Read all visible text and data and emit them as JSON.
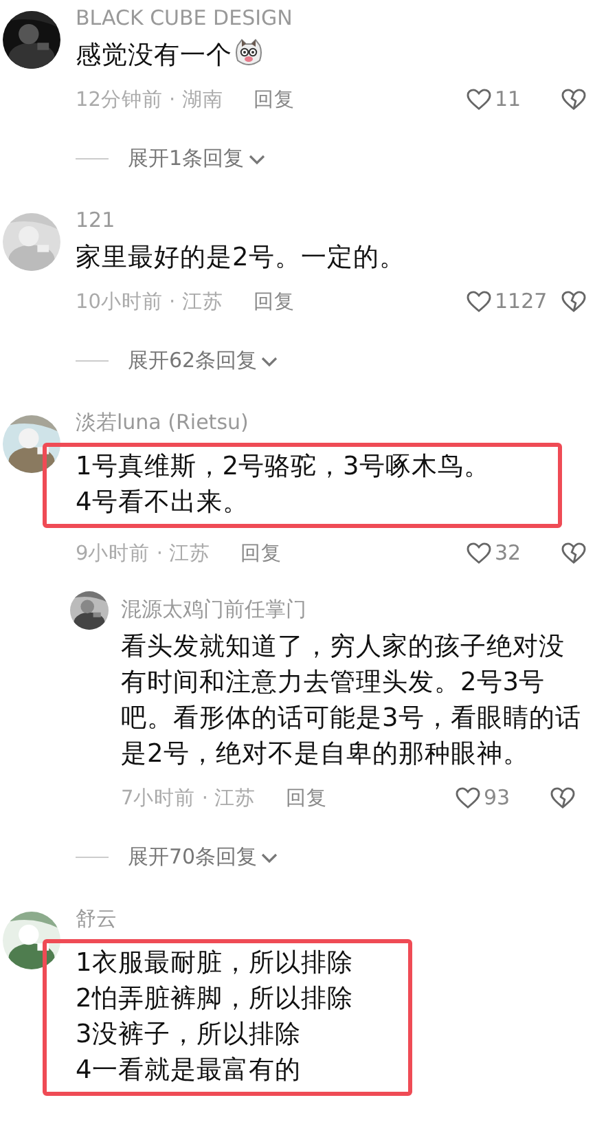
{
  "comments": [
    {
      "name": "BLACK CUBE DESIGN",
      "text": "感觉没有一个",
      "sticker": true,
      "time": "12分钟前 · 湖南",
      "reply": "回复",
      "likes": "11",
      "highlighted": false,
      "expand": "展开1条回复"
    },
    {
      "name": "121",
      "text": "家里最好的是2号。一定的。",
      "time": "10小时前 · 江苏",
      "reply": "回复",
      "likes": "1127",
      "highlighted": false,
      "expand": "展开62条回复"
    },
    {
      "name": "淡若luna (Rietsu)",
      "text": "1号真维斯，2号骆驼，3号啄木鸟。4号看不出来。",
      "time": "9小时前 · 江苏",
      "reply": "回复",
      "likes": "32",
      "highlighted": true,
      "replies": [
        {
          "name": "混源太鸡门前任掌门",
          "text": "看头发就知道了，穷人家的孩子绝对没有时间和注意力去管理头发。2号3号吧。看形体的话可能是3号，看眼睛的话是2号，绝对不是自卑的那种眼神。",
          "time": "7小时前 · 江苏",
          "reply": "回复",
          "likes": "93",
          "highlighted": false
        }
      ],
      "expand": "展开70条回复"
    },
    {
      "name": "舒云",
      "text": "1衣服最耐脏，所以排除\n2怕弄脏裤脚，所以排除\n3没裤子，所以排除\n4一看就是最富有的",
      "highlighted": true
    }
  ]
}
